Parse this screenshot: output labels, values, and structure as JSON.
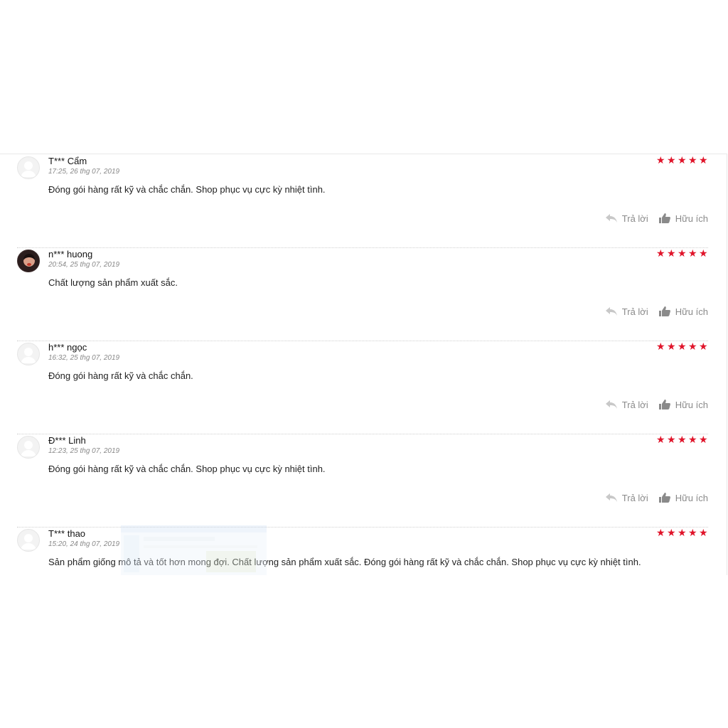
{
  "colors": {
    "star": "#e0142a",
    "action_text": "#8a8a8a",
    "divider": "#cfcfcf"
  },
  "reviews": [
    {
      "name": "T*** Cẩm",
      "date": "17:25, 26 thg 07, 2019",
      "rating": 5,
      "avatar": "default-avatar-icon",
      "comment": "Đóng gói hàng rất kỹ và chắc chắn. Shop phục vụ cực kỳ nhiệt tình."
    },
    {
      "name": "n*** huong",
      "date": "20:54, 25 thg 07, 2019",
      "rating": 5,
      "avatar": "user-photo",
      "comment": "Chất lượng sản phẩm xuất sắc."
    },
    {
      "name": "h*** ngọc",
      "date": "16:32, 25 thg 07, 2019",
      "rating": 5,
      "avatar": "default-avatar-icon",
      "comment": "Đóng gói hàng rất kỹ và chắc chắn."
    },
    {
      "name": "Đ*** Linh",
      "date": "12:23, 25 thg 07, 2019",
      "rating": 5,
      "avatar": "default-avatar-icon",
      "comment": "Đóng gói hàng rất kỹ và chắc chắn. Shop phục vụ cực kỳ nhiệt tình."
    },
    {
      "name": "T*** thao",
      "date": "15:20, 24 thg 07, 2019",
      "rating": 5,
      "avatar": "default-avatar-icon",
      "comment": "Sản phẩm giống mô tả và tốt hơn mong đợi. Chất lượng sản phẩm xuất sắc. Đóng gói hàng rất kỹ và chắc chắn. Shop phục vụ cực kỳ nhiệt tình."
    }
  ],
  "actions": {
    "reply_label": "Trả lời",
    "helpful_label": "Hữu ích",
    "reply_icon": "reply-icon",
    "helpful_icon": "thumbs-up-icon"
  }
}
